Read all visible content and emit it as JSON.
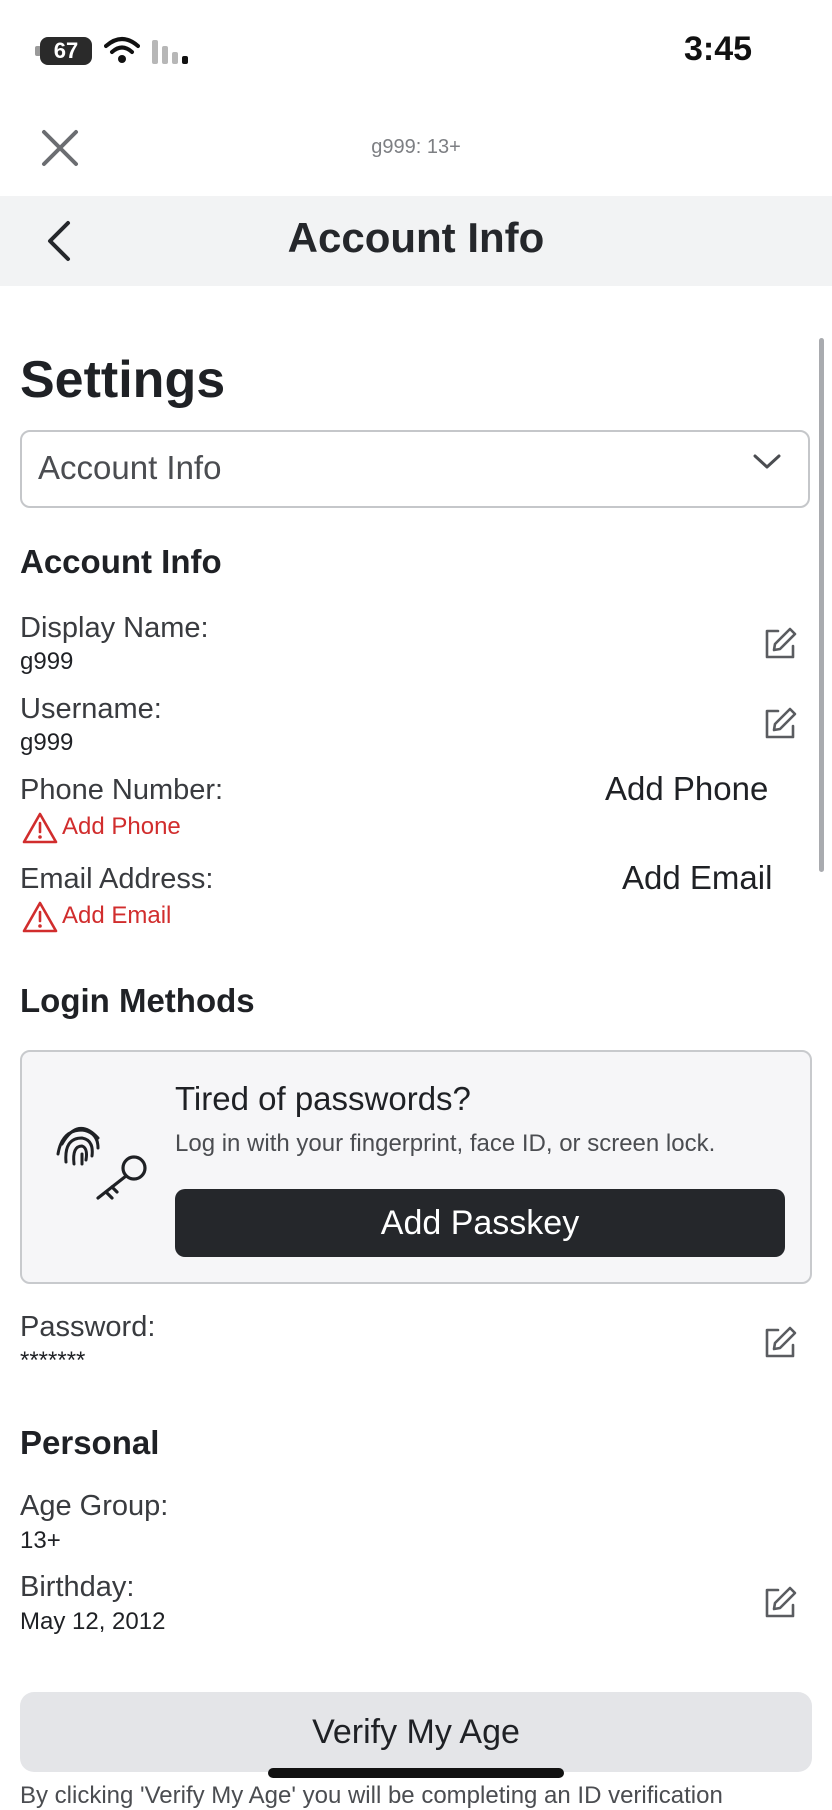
{
  "status_bar": {
    "time": "3:45",
    "battery": "67"
  },
  "header": {
    "subtitle": "g999: 13+",
    "title": "Account Info"
  },
  "page": {
    "heading": "Settings",
    "dropdown_value": "Account Info"
  },
  "account_info": {
    "section_title": "Account Info",
    "display_name_label": "Display Name:",
    "display_name_value": "g999",
    "username_label": "Username:",
    "username_value": "g999",
    "phone_label": "Phone Number:",
    "phone_warning": "Add Phone",
    "phone_action": "Add Phone",
    "email_label": "Email Address:",
    "email_warning": "Add Email",
    "email_action": "Add Email"
  },
  "login_methods": {
    "section_title": "Login Methods",
    "card_title": "Tired of passwords?",
    "card_desc": "Log in with your fingerprint, face ID, or screen lock.",
    "passkey_button": "Add Passkey",
    "password_label": "Password:",
    "password_value": "*******"
  },
  "personal": {
    "section_title": "Personal",
    "age_group_label": "Age Group:",
    "age_group_value": "13+",
    "birthday_label": "Birthday:",
    "birthday_value": "May 12, 2012"
  },
  "verify": {
    "button": "Verify My Age",
    "footer": "By clicking 'Verify My Age' you will be completing an ID verification"
  },
  "colors": {
    "warning": "#d12d2d",
    "primary_button": "#25272b",
    "navbar_bg": "#f2f3f4"
  }
}
